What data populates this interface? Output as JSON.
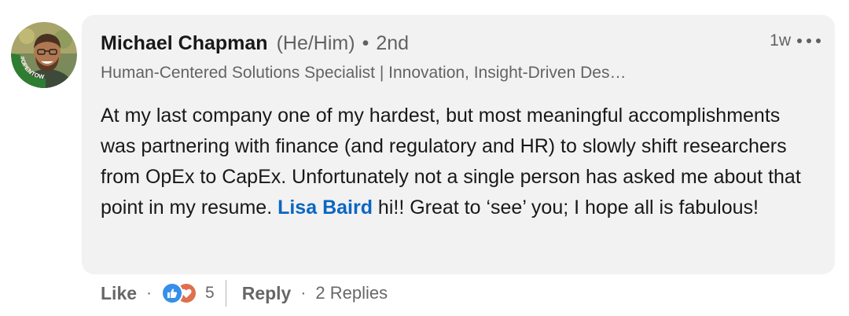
{
  "author": {
    "name": "Michael Chapman",
    "pronouns": "(He/Him)",
    "separator": "•",
    "degree": "2nd",
    "headline": "Human-Centered Solutions Specialist | Innovation, Insight-Driven Des…",
    "badge_text": "#OPENTOWORK"
  },
  "meta": {
    "timestamp": "1w",
    "more_icon": "more-horizontal-icon"
  },
  "comment": {
    "text_before_mention": "At my last company one of my hardest, but most meaningful accomplishments was partnering with finance (and regulatory and HR) to slowly shift researchers from OpEx to CapEx. Unfortunately not a single person has asked me about that point in my resume. ",
    "mention": "Lisa Baird",
    "text_after_mention": " hi!! Great to ‘see’ you; I hope all is fabulous!"
  },
  "actions": {
    "like_label": "Like",
    "dot": "·",
    "reaction_icons": [
      "like-reaction-icon",
      "love-reaction-icon"
    ],
    "reaction_count": "5",
    "reply_label": "Reply",
    "replies_label": "2 Replies"
  },
  "colors": {
    "bubble_bg": "#f2f2f2",
    "mention": "#0a66c2",
    "like_reaction": "#378fe9",
    "love_reaction": "#df704d",
    "open_to_work_ring": "#2e7d32"
  }
}
